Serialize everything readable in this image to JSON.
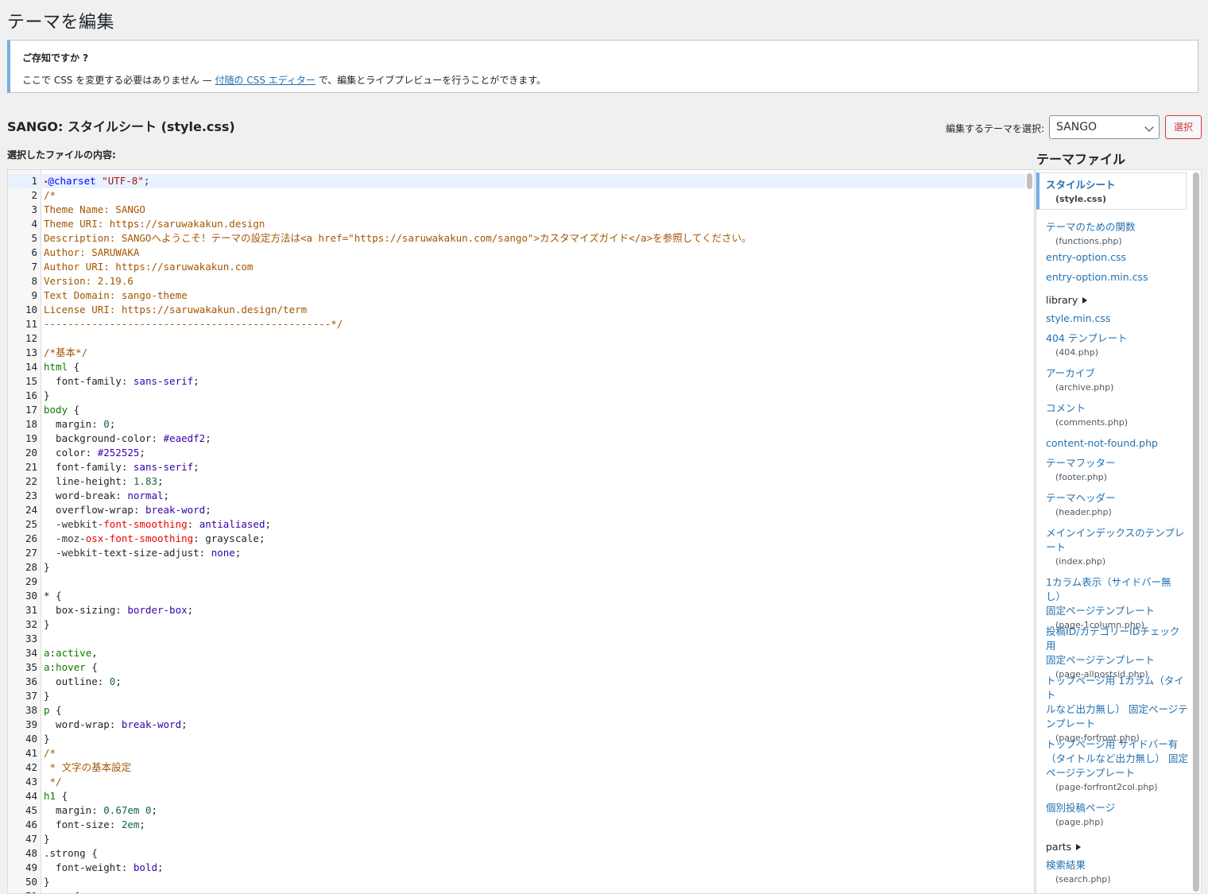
{
  "page": {
    "title": "テーマを編集"
  },
  "notice": {
    "title": "ご存知ですか ?",
    "body_before": "ここで CSS を変更する必要はありません — ",
    "link": "付随の CSS エディター",
    "body_after": " で、編集とライブプレビューを行うことができます。"
  },
  "file_heading": "SANGO: スタイルシート (style.css)",
  "theme_select": {
    "label": "編集するテーマを選択:",
    "value": "SANGO",
    "button": "選択"
  },
  "content_label": "選択したファイルの内容:",
  "sidebar": {
    "title": "テーマファイル",
    "files": [
      {
        "name": "スタイルシート",
        "file": "(style.css)",
        "current": true
      },
      {
        "name": "テーマのための関数",
        "file": "(functions.php)"
      },
      {
        "name": "entry-option.css",
        "file": ""
      },
      {
        "name": "entry-option.min.css",
        "file": ""
      },
      {
        "name": "library",
        "folder": true
      },
      {
        "name": "style.min.css",
        "file": ""
      },
      {
        "name": "404 テンプレート",
        "file": "(404.php)"
      },
      {
        "name": "アーカイブ",
        "file": "(archive.php)"
      },
      {
        "name": "コメント",
        "file": "(comments.php)"
      },
      {
        "name": "content-not-found.php",
        "file": ""
      },
      {
        "name": "テーマフッター",
        "file": "(footer.php)"
      },
      {
        "name": "テーマヘッダー",
        "file": "(header.php)"
      },
      {
        "name": "メインインデックスのテンプレ\nート",
        "file": "(index.php)"
      },
      {
        "name": "1カラム表示（サイドバー無し）\n固定ページテンプレート",
        "file": "(page-1column.php)"
      },
      {
        "name": "投稿ID/カテゴリーIDチェック用\n固定ページテンプレート",
        "file": "(page-allpostsid.php)"
      },
      {
        "name": "トップページ用 1カラム（タイト\nルなど出力無し） 固定ページテ\nンプレート",
        "file": "(page-forfront.php)"
      },
      {
        "name": "トップページ用 サイドバー有\n（タイトルなど出力無し） 固定\nページテンプレート",
        "file": "(page-forfront2col.php)"
      },
      {
        "name": "個別投稿ページ",
        "file": "(page.php)"
      },
      {
        "name": "parts",
        "folder": true
      },
      {
        "name": "検索結果",
        "file": "(search.php)"
      }
    ]
  },
  "code_lines": [
    [
      [
        "str-dot",
        "•"
      ],
      [
        "def",
        "@charset"
      ],
      [
        "",
        ""
      ],
      [
        "str",
        " \"UTF-8\""
      ],
      [
        "",
        ";"
      ]
    ],
    [
      [
        "cmt",
        "/*"
      ]
    ],
    [
      [
        "cmt",
        "Theme Name: SANGO"
      ]
    ],
    [
      [
        "cmt",
        "Theme URI: https://saruwakakun.design"
      ]
    ],
    [
      [
        "cmt",
        "Description: SANGOへようこそ！テーマの設定方法は<a href=\"https://saruwakakun.com/sango\">カスタマイズガイド</a>を参照してください。"
      ]
    ],
    [
      [
        "cmt",
        "Author: SARUWAKA"
      ]
    ],
    [
      [
        "cmt",
        "Author URI: https://saruwakakun.com"
      ]
    ],
    [
      [
        "cmt",
        "Version: 2.19.6"
      ]
    ],
    [
      [
        "cmt",
        "Text Domain: sango-theme"
      ]
    ],
    [
      [
        "cmt",
        "License URI: https://saruwakakun.design/term"
      ]
    ],
    [
      [
        "cmt",
        "------------------------------------------------*/"
      ]
    ],
    [],
    [
      [
        "cmt",
        "/*基本*/"
      ]
    ],
    [
      [
        "kw",
        "html"
      ],
      [
        "",
        " {"
      ]
    ],
    [
      [
        "",
        "  font-family: "
      ],
      [
        "atom",
        "sans-serif"
      ],
      [
        "",
        ";"
      ]
    ],
    [
      [
        "",
        "}"
      ]
    ],
    [
      [
        "kw",
        "body"
      ],
      [
        "",
        " {"
      ]
    ],
    [
      [
        "",
        "  margin: "
      ],
      [
        "num",
        "0"
      ],
      [
        "",
        ";"
      ]
    ],
    [
      [
        "",
        "  background-color: "
      ],
      [
        "atom",
        "#eaedf2"
      ],
      [
        "",
        ";"
      ]
    ],
    [
      [
        "",
        "  color: "
      ],
      [
        "atom",
        "#252525"
      ],
      [
        "",
        ";"
      ]
    ],
    [
      [
        "",
        "  font-family: "
      ],
      [
        "atom",
        "sans-serif"
      ],
      [
        "",
        ";"
      ]
    ],
    [
      [
        "",
        "  line-height: "
      ],
      [
        "num",
        "1.83"
      ],
      [
        "",
        ";"
      ]
    ],
    [
      [
        "",
        "  word-break: "
      ],
      [
        "atom",
        "normal"
      ],
      [
        "",
        ";"
      ]
    ],
    [
      [
        "",
        "  overflow-wrap: "
      ],
      [
        "atom",
        "break-word"
      ],
      [
        "",
        ";"
      ]
    ],
    [
      [
        "vendor",
        "  -webkit-"
      ],
      [
        "neg",
        "font-smoothing"
      ],
      [
        "",
        ": "
      ],
      [
        "atom",
        "antialiased"
      ],
      [
        "",
        ";"
      ]
    ],
    [
      [
        "vendor",
        "  -moz-"
      ],
      [
        "neg",
        "osx-font-smoothing"
      ],
      [
        "",
        ": grayscale;"
      ]
    ],
    [
      [
        "vendor",
        "  -webkit-"
      ],
      [
        "",
        "text-size-adjust: "
      ],
      [
        "atom",
        "none"
      ],
      [
        "",
        ";"
      ]
    ],
    [
      [
        "",
        "}"
      ]
    ],
    [],
    [
      [
        "",
        "* {"
      ]
    ],
    [
      [
        "",
        "  box-sizing: "
      ],
      [
        "atom",
        "border-box"
      ],
      [
        "",
        ";"
      ]
    ],
    [
      [
        "",
        "}"
      ]
    ],
    [],
    [
      [
        "kw",
        "a"
      ],
      [
        "",
        ":"
      ],
      [
        "kw",
        "active"
      ],
      [
        "",
        ","
      ]
    ],
    [
      [
        "kw",
        "a"
      ],
      [
        "",
        ":"
      ],
      [
        "kw",
        "hover"
      ],
      [
        "",
        " {"
      ]
    ],
    [
      [
        "",
        "  outline: "
      ],
      [
        "num",
        "0"
      ],
      [
        "",
        ";"
      ]
    ],
    [
      [
        "",
        "}"
      ]
    ],
    [
      [
        "kw",
        "p"
      ],
      [
        "",
        " {"
      ]
    ],
    [
      [
        "",
        "  word-wrap: "
      ],
      [
        "atom",
        "break-word"
      ],
      [
        "",
        ";"
      ]
    ],
    [
      [
        "",
        "}"
      ]
    ],
    [
      [
        "cmt",
        "/*"
      ]
    ],
    [
      [
        "cmt",
        " * 文字の基本設定"
      ]
    ],
    [
      [
        "cmt",
        " */"
      ]
    ],
    [
      [
        "kw",
        "h1"
      ],
      [
        "",
        " {"
      ]
    ],
    [
      [
        "",
        "  margin: "
      ],
      [
        "num",
        "0.67em"
      ],
      [
        "",
        " "
      ],
      [
        "num",
        "0"
      ],
      [
        "",
        ";"
      ]
    ],
    [
      [
        "",
        "  font-size: "
      ],
      [
        "num",
        "2em"
      ],
      [
        "",
        ";"
      ]
    ],
    [
      [
        "",
        "}"
      ]
    ],
    [
      [
        "",
        "."
      ],
      [
        "",
        "strong {"
      ]
    ],
    [
      [
        "",
        "  font-weight: "
      ],
      [
        "atom",
        "bold"
      ],
      [
        "",
        ";"
      ]
    ],
    [
      [
        "",
        "}"
      ]
    ],
    [
      [
        "",
        "  "
      ],
      [
        "",
        ".. {"
      ]
    ]
  ]
}
